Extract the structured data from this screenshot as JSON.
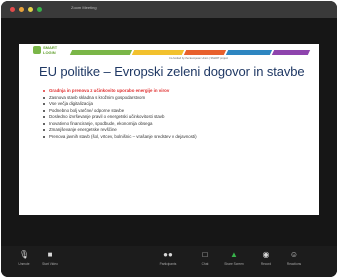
{
  "window": {
    "title": "Zoom Meeting"
  },
  "titlebar_dots": [
    "#e24b4b",
    "#e9a23b",
    "#e3d24a",
    "#37b34a"
  ],
  "slide": {
    "logo_text": "SMART\nLOGIN",
    "tagline": "Co-funded by the European Union  |  SMART project",
    "title": "EU politike – Evropski zeleni dogovor in stavbe",
    "bullets": [
      "Gradnja in prenova z učinkovito uporabo energije in virov",
      "Zasnova stavb skladna s krožnim gospodarstvom",
      "Vse večja digitalizacija",
      "Podnebno bolj varčne/ odporne stavbe",
      "Dosledno izvrševanje pravil o energetski učinkovitosti stavb",
      "Inovativno financiranje, spodbude, ekonomija obsega",
      "Zmanjševanje energetske revščine",
      "Prenova javnih stavb (šol, vrtcev, bolnišnic – vrašanje sredstev v dejavnosti)"
    ],
    "colors": {
      "title": "#1f3864",
      "highlight": "#e03030",
      "strip": [
        "#7ab648",
        "#f2c12e",
        "#e8602c",
        "#2e86c1",
        "#8e44ad"
      ]
    }
  },
  "toolbar": {
    "items": [
      {
        "label": "Unmute",
        "icon": "microphone-icon"
      },
      {
        "label": "Start Video",
        "icon": "video-camera-icon"
      },
      {
        "label": "Participants",
        "icon": "participants-icon"
      },
      {
        "label": "Chat",
        "icon": "chat-icon"
      },
      {
        "label": "Share Screen",
        "icon": "share-screen-icon"
      },
      {
        "label": "Record",
        "icon": "record-icon"
      },
      {
        "label": "Reactions",
        "icon": "reactions-icon"
      }
    ],
    "share_color": "#37b34a"
  }
}
